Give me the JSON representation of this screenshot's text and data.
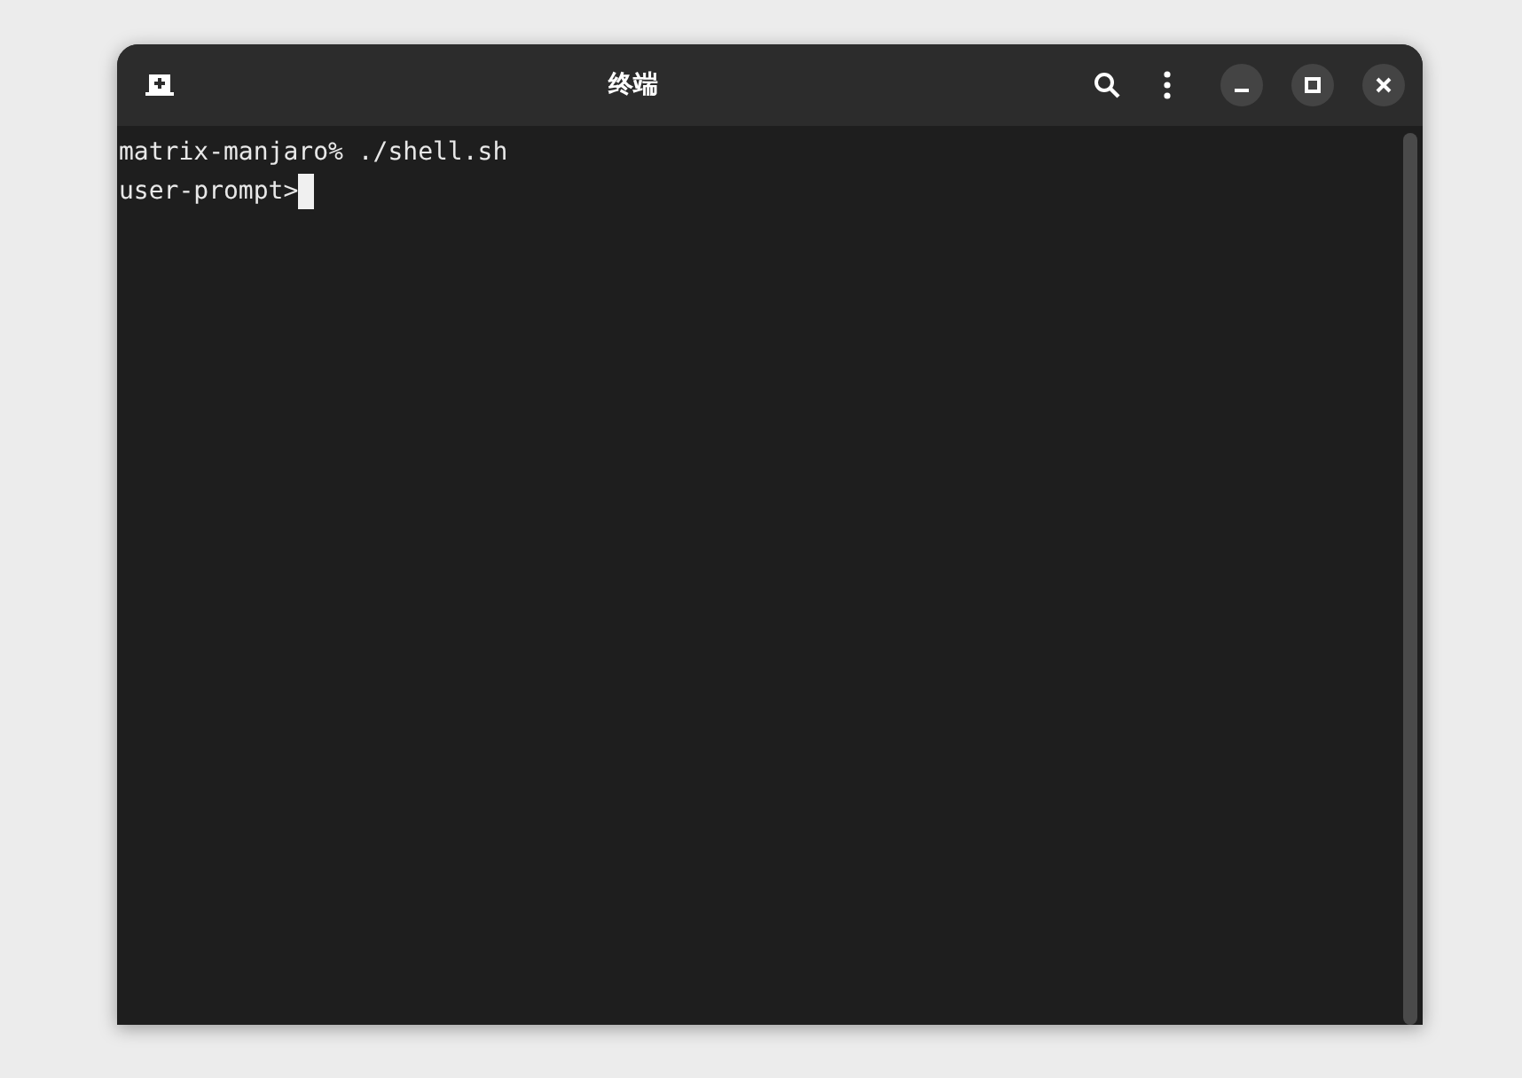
{
  "window": {
    "title": "终端"
  },
  "terminal": {
    "lines": [
      {
        "text": "matrix-manjaro% ./shell.sh",
        "cursor": false
      },
      {
        "text": "user-prompt>",
        "cursor": true
      }
    ]
  }
}
